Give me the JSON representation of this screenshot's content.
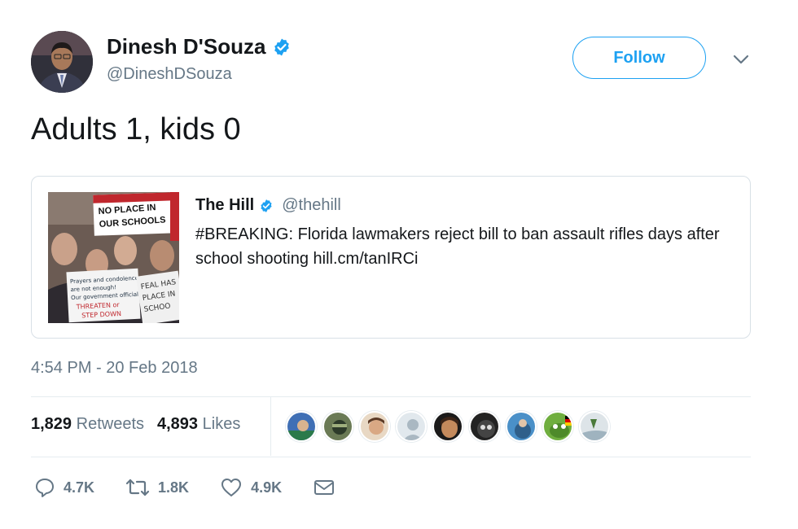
{
  "author": {
    "name": "Dinesh D'Souza",
    "handle": "@DineshDSouza",
    "verified": true
  },
  "follow_button": {
    "label": "Follow"
  },
  "tweet": {
    "text": "Adults 1, kids 0"
  },
  "quoted_tweet": {
    "name": "The Hill",
    "handle": "@thehill",
    "verified": true,
    "text": "#BREAKING: Florida lawmakers reject bill to ban assault rifles days after school shooting hill.cm/tanIRCi",
    "image_signs": [
      "NO PLACE IN OUR SCHOOLS",
      "Prayers and condolences are not enough! Our government officials need to THREATEN or STEP DOWN",
      "FEAL HAS PLACE IN SCHOO"
    ]
  },
  "timestamp": "4:54 PM - 20 Feb 2018",
  "stats": {
    "retweets_count": "1,829",
    "retweets_label": "Retweets",
    "likes_count": "4,893",
    "likes_label": "Likes"
  },
  "actions": {
    "reply_count": "4.7K",
    "retweet_count": "1.8K",
    "like_count": "4.9K"
  },
  "colors": {
    "accent": "#1da1f2",
    "secondary_text": "#657786",
    "border": "#e6ecf0"
  },
  "icons": [
    "verified-badge-icon",
    "chevron-down-icon",
    "reply-icon",
    "retweet-icon",
    "heart-icon",
    "envelope-icon"
  ]
}
